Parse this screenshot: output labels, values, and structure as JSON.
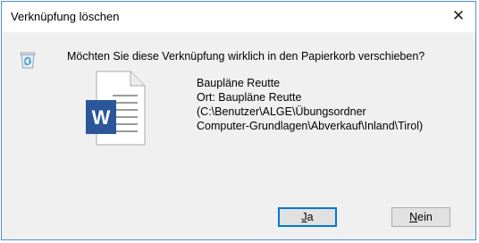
{
  "window": {
    "title": "Verknüpfung löschen",
    "close_symbol": "✕"
  },
  "message": {
    "question": "Möchten Sie diese Verknüpfung wirklich in den Papierkorb verschieben?",
    "item_name": "Baupläne Reutte",
    "location_line": "Ort: Baupläne Reutte",
    "path_line1": "(C:\\Benutzer\\ALGE\\Übungsordner",
    "path_line2": "Computer-Grundlagen\\Abverkauf\\Inland\\Tirol)"
  },
  "icons": {
    "dialog_icon": "recycle-bin-icon",
    "file_icon": "word-document-icon",
    "file_icon_letter": "W"
  },
  "buttons": {
    "yes_mnemonic": "J",
    "yes_rest": "a",
    "no_mnemonic": "N",
    "no_rest": "ein"
  },
  "colors": {
    "word_blue": "#2b579a",
    "accent": "#0078d7"
  }
}
